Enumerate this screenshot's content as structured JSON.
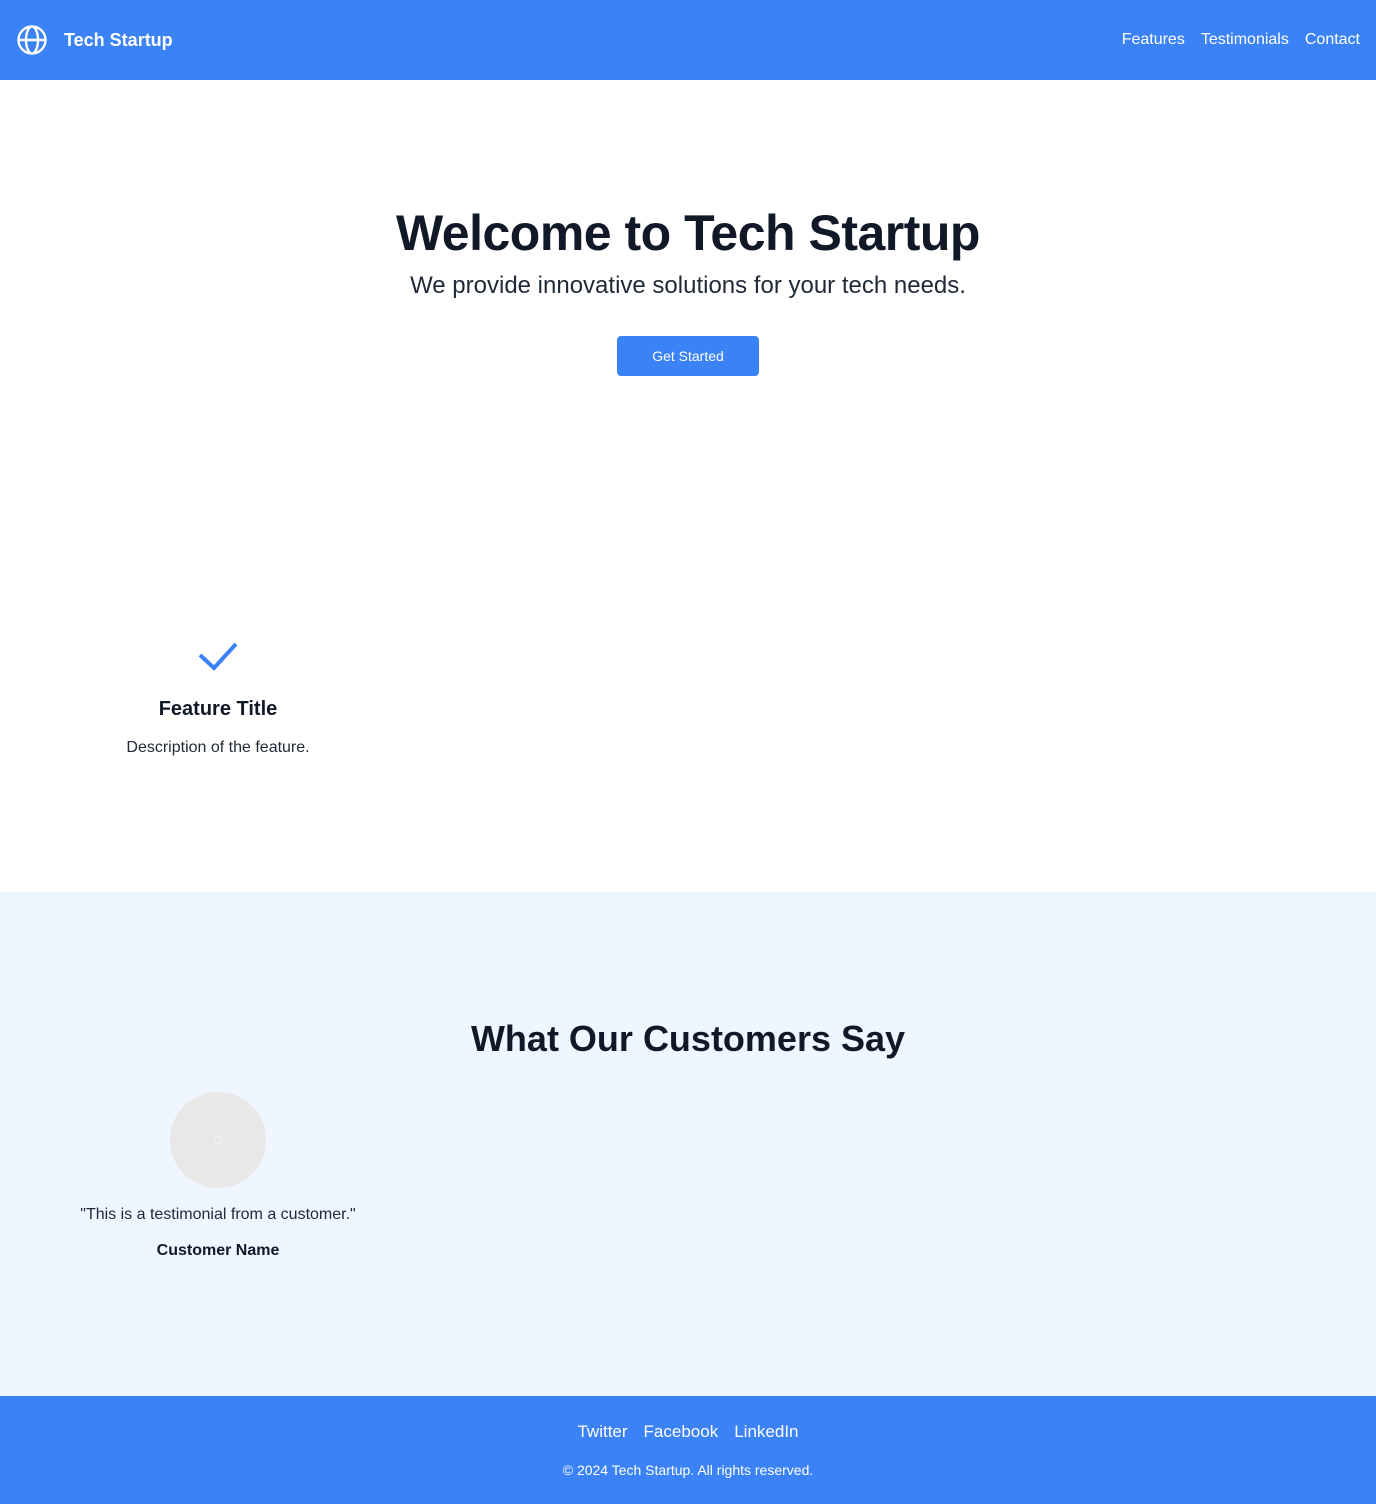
{
  "header": {
    "logo_icon": "globe-icon",
    "brand": "Tech Startup",
    "nav": [
      "Features",
      "Testimonials",
      "Contact"
    ]
  },
  "hero": {
    "title": "Welcome to Tech Startup",
    "subtitle": "We provide innovative solutions for your tech needs.",
    "cta_label": "Get Started"
  },
  "features": {
    "items": [
      {
        "icon": "check-icon",
        "title": "Feature Title",
        "description": "Description of the feature."
      }
    ]
  },
  "testimonials": {
    "heading": "What Our Customers Say",
    "items": [
      {
        "avatar": "avatar-placeholder",
        "quote": "\"This is a testimonial from a customer.\"",
        "name": "Customer Name"
      }
    ]
  },
  "footer": {
    "social": [
      "Twitter",
      "Facebook",
      "LinkedIn"
    ],
    "copyright": "© 2024 Tech Startup. All rights reserved."
  },
  "colors": {
    "primary": "#3b82f6",
    "text_dark": "#111827",
    "section_tint": "#eff6ff",
    "avatar_bg": "#e8e8e8"
  }
}
